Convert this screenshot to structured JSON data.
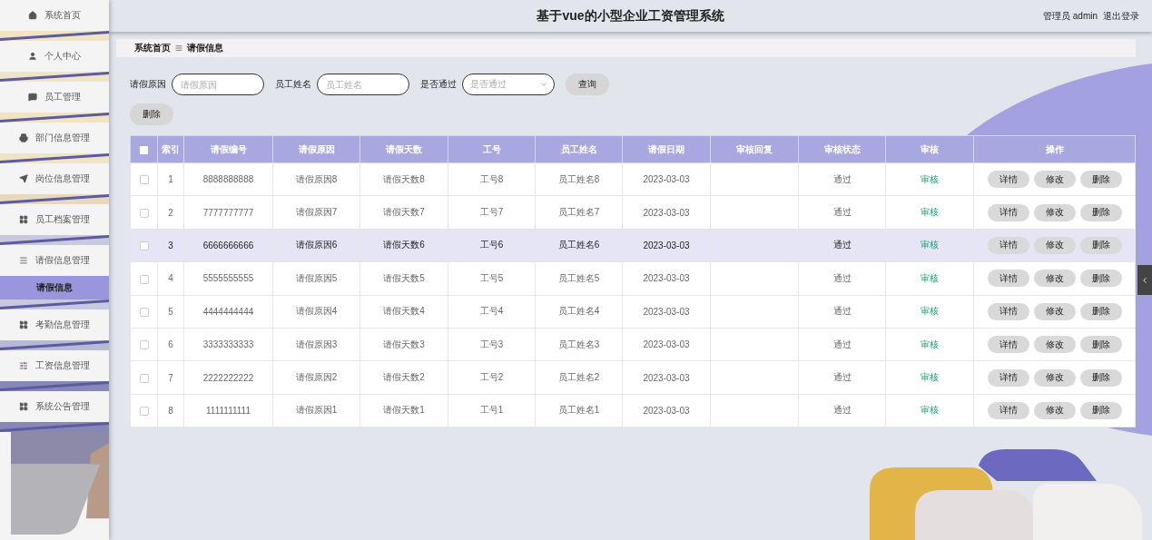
{
  "header": {
    "title": "基于vue的小型企业工资管理系统",
    "user": "管理员 admin",
    "logout": "退出登录"
  },
  "sidebar": {
    "items": [
      {
        "label": "系统首页"
      },
      {
        "label": "个人中心"
      },
      {
        "label": "员工管理"
      },
      {
        "label": "部门信息管理"
      },
      {
        "label": "岗位信息管理"
      },
      {
        "label": "员工档案管理"
      },
      {
        "label": "请假信息管理",
        "children": [
          {
            "label": "请假信息",
            "selected": true
          }
        ]
      },
      {
        "label": "考勤信息管理"
      },
      {
        "label": "工资信息管理"
      },
      {
        "label": "系统公告管理"
      }
    ]
  },
  "breadcrumb": [
    "系统首页",
    "请假信息"
  ],
  "search": {
    "fields": [
      {
        "kind": "input",
        "label": "请假原因",
        "placeholder": "请假原因"
      },
      {
        "kind": "input",
        "label": "员工姓名",
        "placeholder": "员工姓名"
      },
      {
        "kind": "select",
        "label": "是否通过",
        "placeholder": "是否通过"
      }
    ],
    "button": "查询"
  },
  "delete_button": "删除",
  "table": {
    "all_checked": false,
    "columns": [
      "索引",
      "请假编号",
      "请假原因",
      "请假天数",
      "工号",
      "员工姓名",
      "请假日期",
      "审核回复",
      "审核状态",
      "审核",
      "操作"
    ],
    "rows": [
      {
        "checked": false,
        "hovered": false,
        "index": "1",
        "leave_no": "8888888888",
        "reason": "请假原因8",
        "days": "请假天数8",
        "emp_no": "工号8",
        "emp_name": "员工姓名8",
        "date": "2023-03-03",
        "status": "通过",
        "audit": "审核",
        "actions": [
          "详情",
          "修改",
          "删除"
        ]
      },
      {
        "checked": false,
        "hovered": false,
        "index": "2",
        "leave_no": "7777777777",
        "reason": "请假原因7",
        "days": "请假天数7",
        "emp_no": "工号7",
        "emp_name": "员工姓名7",
        "date": "2023-03-03",
        "status": "通过",
        "audit": "审核",
        "actions": [
          "详情",
          "修改",
          "删除"
        ]
      },
      {
        "checked": false,
        "hovered": true,
        "index": "3",
        "leave_no": "6666666666",
        "reason": "请假原因6",
        "days": "请假天数6",
        "emp_no": "工号6",
        "emp_name": "员工姓名6",
        "date": "2023-03-03",
        "status": "通过",
        "audit": "审核",
        "actions": [
          "详情",
          "修改",
          "删除"
        ]
      },
      {
        "checked": false,
        "hovered": false,
        "index": "4",
        "leave_no": "5555555555",
        "reason": "请假原因5",
        "days": "请假天数5",
        "emp_no": "工号5",
        "emp_name": "员工姓名5",
        "date": "2023-03-03",
        "status": "通过",
        "audit": "审核",
        "actions": [
          "详情",
          "修改",
          "删除"
        ]
      },
      {
        "checked": false,
        "hovered": false,
        "index": "5",
        "leave_no": "4444444444",
        "reason": "请假原因4",
        "days": "请假天数4",
        "emp_no": "工号4",
        "emp_name": "员工姓名4",
        "date": "2023-03-03",
        "status": "通过",
        "audit": "审核",
        "actions": [
          "详情",
          "修改",
          "删除"
        ]
      },
      {
        "checked": false,
        "hovered": false,
        "index": "6",
        "leave_no": "3333333333",
        "reason": "请假原因3",
        "days": "请假天数3",
        "emp_no": "工号3",
        "emp_name": "员工姓名3",
        "date": "2023-03-03",
        "status": "通过",
        "audit": "审核",
        "actions": [
          "详情",
          "修改",
          "删除"
        ]
      },
      {
        "checked": false,
        "hovered": false,
        "index": "7",
        "leave_no": "2222222222",
        "reason": "请假原因2",
        "days": "请假天数2",
        "emp_no": "工号2",
        "emp_name": "员工姓名2",
        "date": "2023-03-03",
        "status": "通过",
        "audit": "审核",
        "actions": [
          "详情",
          "修改",
          "删除"
        ]
      },
      {
        "checked": false,
        "hovered": false,
        "index": "8",
        "leave_no": "1111111111",
        "reason": "请假原因1",
        "days": "请假天数1",
        "emp_no": "工号1",
        "emp_name": "员工姓名1",
        "date": "2023-03-03",
        "status": "通过",
        "audit": "审核",
        "actions": [
          "详情",
          "修改",
          "删除"
        ]
      }
    ]
  }
}
